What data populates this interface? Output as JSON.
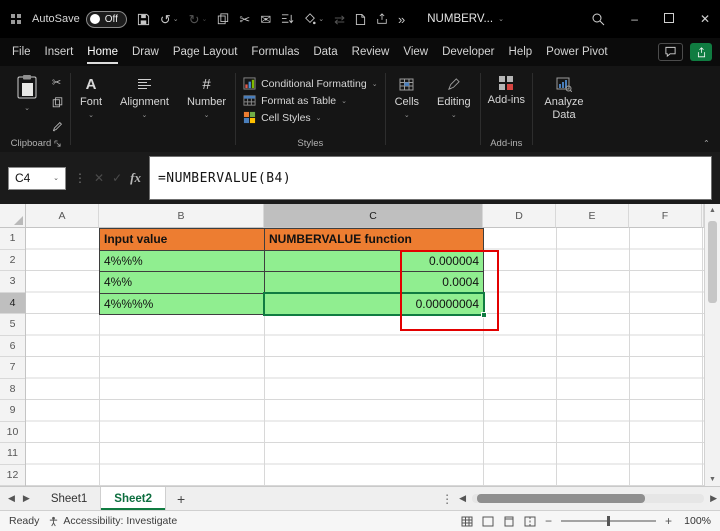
{
  "titlebar": {
    "autosave_label": "AutoSave",
    "autosave_state": "Off",
    "doc_title": "NUMBERV...",
    "more_commands": "»"
  },
  "menu": {
    "tabs": [
      "File",
      "Insert",
      "Home",
      "Draw",
      "Page Layout",
      "Formulas",
      "Data",
      "Review",
      "View",
      "Developer",
      "Help",
      "Power Pivot"
    ],
    "active_tab": "Home"
  },
  "ribbon": {
    "clipboard_group_label": "Clipboard",
    "font_group_label": "Font",
    "alignment_group_label": "Alignment",
    "number_group_label": "Number",
    "conditional_formatting_label": "Conditional Formatting",
    "format_as_table_label": "Format as Table",
    "cell_styles_label": "Cell Styles",
    "styles_group_label": "Styles",
    "cells_group_label": "Cells",
    "editing_group_label": "Editing",
    "addins_button_label": "Add-ins",
    "addins_group_label": "Add-ins",
    "analyze_data_label": "Analyze Data"
  },
  "formula_bar": {
    "name_box": "C4",
    "fx_label": "fx",
    "formula": "=NUMBERVALUE(B4)"
  },
  "grid": {
    "col_headers": [
      "A",
      "B",
      "C",
      "D",
      "E",
      "F"
    ],
    "row_headers": [
      "1",
      "2",
      "3",
      "4",
      "5",
      "6",
      "7",
      "8",
      "9",
      "10",
      "11",
      "12"
    ],
    "cells": {
      "b1": "Input value",
      "c1": "NUMBERVALUE function",
      "b2": "4%%%",
      "c2": "0.000004",
      "b3": "4%%",
      "c3": "0.0004",
      "b4": "4%%%%",
      "c4": "0.00000004"
    },
    "selected_cell": "C4",
    "colors": {
      "header_fill": "#ED7D31",
      "data_fill": "#90EE90",
      "annotation_border": "#E30000",
      "selection_border": "#107C41"
    }
  },
  "sheet_tabs": {
    "tabs": [
      "Sheet1",
      "Sheet2"
    ],
    "active": "Sheet2",
    "add_label": "+"
  },
  "status_bar": {
    "mode": "Ready",
    "accessibility": "Accessibility: Investigate",
    "zoom": "100%"
  }
}
